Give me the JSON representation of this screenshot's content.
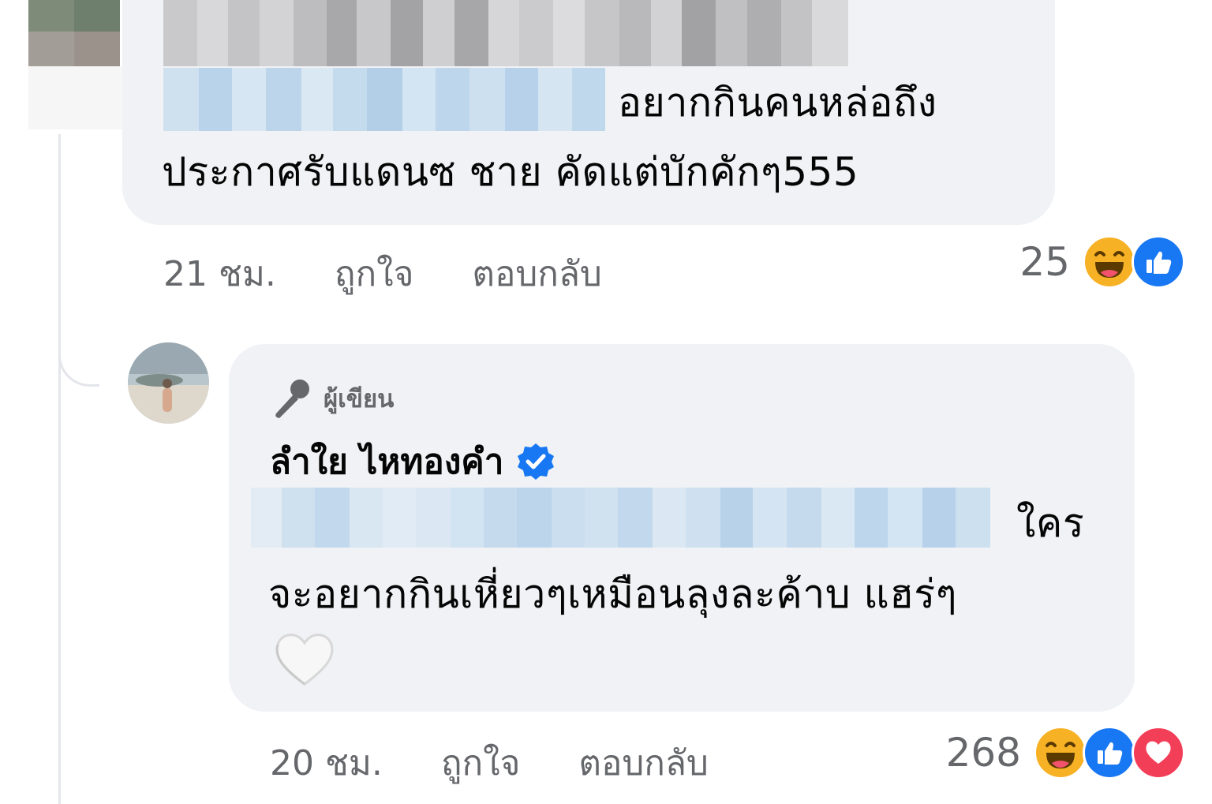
{
  "colors": {
    "bubble_bg": "#f0f2f5",
    "meta_text": "#65676b",
    "body_text": "#050505",
    "like_blue": "#1877f2",
    "love_red": "#f33e58",
    "haha_yellow": "#f7b125",
    "verified_blue": "#1877f2"
  },
  "comment_1": {
    "text_line_1": "อยากกินคนหล่อถึง",
    "text_line_2": "ประกาศรับแดนซ ชาย  คัดแต่บักคักๆ555",
    "time": "21 ชม.",
    "like_label": "ถูกใจ",
    "reply_label": "ตอบกลับ",
    "reaction_count": "25",
    "reactions": [
      "haha-icon",
      "like-icon"
    ]
  },
  "comment_2": {
    "author_badge_label": "ผู้เขียน",
    "author_badge_icon": "microphone-icon",
    "author_name": "ลำใย ไหทองคำ",
    "verified_icon": "verified-badge-icon",
    "text_line_1": "ใคร",
    "text_line_2": "จะอยากกินเหี่ยวๆเหมือนลุงละค้าบ แฮร่ๆ",
    "emoji": "white-heart-icon",
    "time": "20 ชม.",
    "like_label": "ถูกใจ",
    "reply_label": "ตอบกลับ",
    "reaction_count": "268",
    "reactions": [
      "haha-icon",
      "like-icon",
      "love-icon"
    ]
  }
}
